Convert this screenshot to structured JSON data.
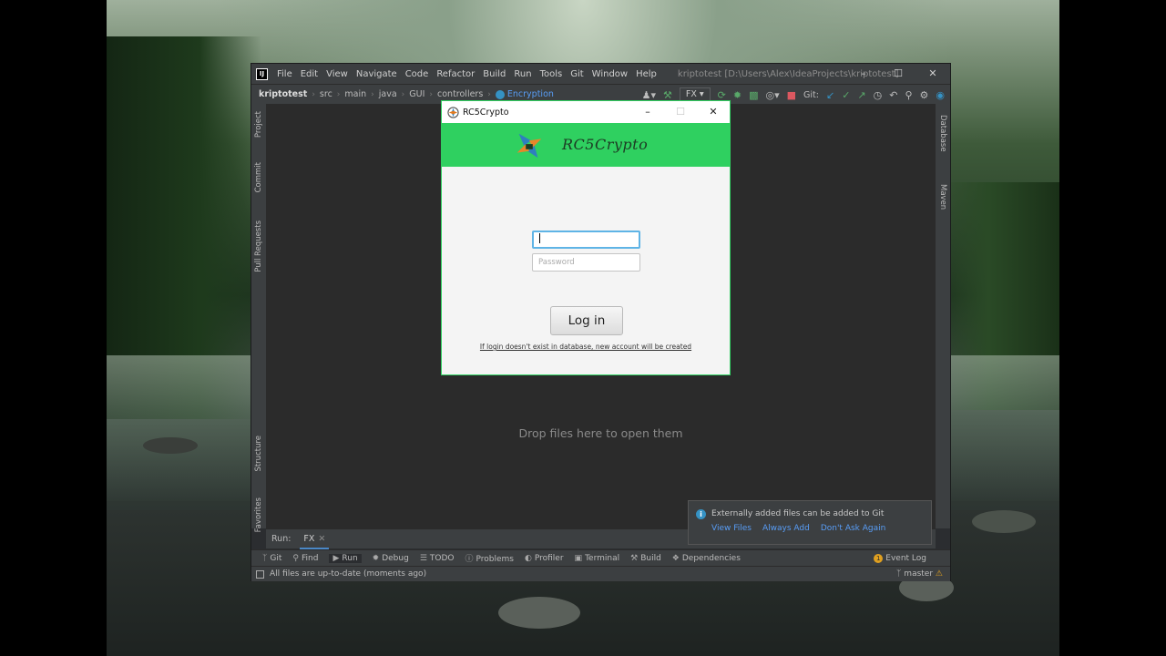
{
  "ide": {
    "menu": [
      "File",
      "Edit",
      "View",
      "Navigate",
      "Code",
      "Refactor",
      "Build",
      "Run",
      "Tools",
      "Git",
      "Window",
      "Help"
    ],
    "window_title": "kriptotest [D:\\Users\\Alex\\IdeaProjects\\kriptotest]",
    "breadcrumbs": [
      "kriptotest",
      "src",
      "main",
      "java",
      "GUI",
      "controllers",
      "Encryption"
    ],
    "run_config": "FX",
    "vcs_label": "Git:",
    "left_tabs": [
      "Project",
      "Commit",
      "Pull Requests",
      "Structure",
      "Favorites"
    ],
    "right_tabs": [
      "Database",
      "Maven"
    ],
    "drop_text": "Drop files here to open them",
    "run_bar": {
      "label": "Run:",
      "tab": "FX"
    },
    "tool_windows": [
      "Git",
      "Find",
      "Run",
      "Debug",
      "TODO",
      "Problems",
      "Profiler",
      "Terminal",
      "Build",
      "Dependencies"
    ],
    "event_log": "Event Log",
    "event_badge": "1",
    "status_text": "All files are up-to-date (moments ago)",
    "branch": "master",
    "notification": {
      "title": "Externally added files can be added to Git",
      "links": [
        "View Files",
        "Always Add",
        "Don't Ask Again"
      ]
    }
  },
  "dialog": {
    "title": "RC5Crypto",
    "brand": "RC5Crypto",
    "username_value": "",
    "password_placeholder": "Password",
    "login_label": "Log in",
    "hint": "If login doesn't exist in database, new account will be created",
    "header_color": "#2fd060"
  },
  "colors": {
    "accent_link": "#589df6",
    "ide_bg": "#2b2b2b",
    "dialog_border": "#2fd060"
  }
}
